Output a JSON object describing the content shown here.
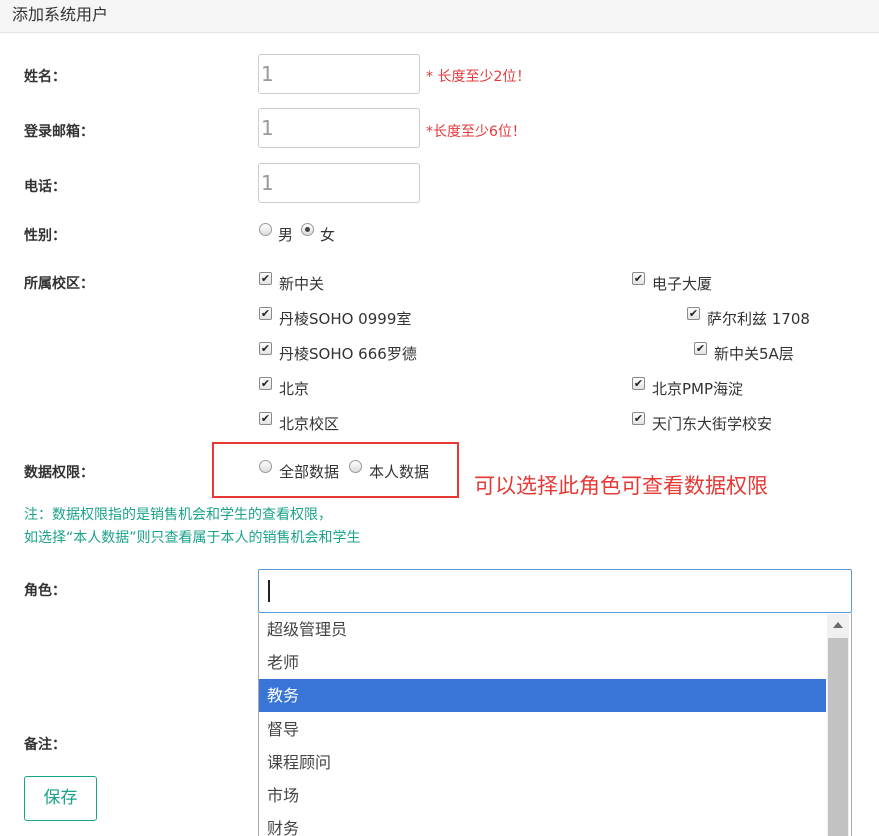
{
  "header": {
    "title": "添加系统用户"
  },
  "form": {
    "name": {
      "label": "姓名：",
      "value": "1",
      "hint": "* 长度至少2位！"
    },
    "email": {
      "label": "登录邮箱：",
      "value": "1",
      "hint": "*长度至少6位！"
    },
    "phone": {
      "label": "电话：",
      "value": "1"
    },
    "gender": {
      "label": "性别：",
      "options": [
        "男",
        "女"
      ],
      "selected": "女"
    },
    "campus": {
      "label": "所属校区：",
      "items": [
        {
          "label": "新中关",
          "checked": true
        },
        {
          "label": "电子大厦",
          "checked": true
        },
        {
          "label": "丹棱SOHO 0999室",
          "checked": true
        },
        {
          "label": "萨尔利兹 1708",
          "checked": true
        },
        {
          "label": "丹棱SOHO 666罗德",
          "checked": true
        },
        {
          "label": "新中关5A层",
          "checked": true
        },
        {
          "label": "北京",
          "checked": true
        },
        {
          "label": "北京PMP海淀",
          "checked": true
        },
        {
          "label": "北京校区",
          "checked": true
        },
        {
          "label": "天门东大街学校安",
          "checked": true
        }
      ]
    },
    "data_permission": {
      "label": "数据权限：",
      "options": [
        "全部数据",
        "本人数据"
      ],
      "selected": null
    },
    "annotation": "可以选择此角色可查看数据权限",
    "note": {
      "line1": "注：数据权限指的是销售机会和学生的查看权限，",
      "line2": "如选择“本人数据”则只查看属于本人的销售机会和学生"
    },
    "role": {
      "label": "角色：",
      "value": "",
      "options": [
        "超级管理员",
        "老师",
        "教务",
        "督导",
        "课程顾问",
        "市场",
        "财务"
      ],
      "highlighted": "教务"
    },
    "remark": {
      "label": "备注："
    },
    "save_label": "保存"
  },
  "colors": {
    "accent_teal": "#1aa38a",
    "error_red": "#e4393c",
    "highlight_blue": "#3875d7"
  }
}
